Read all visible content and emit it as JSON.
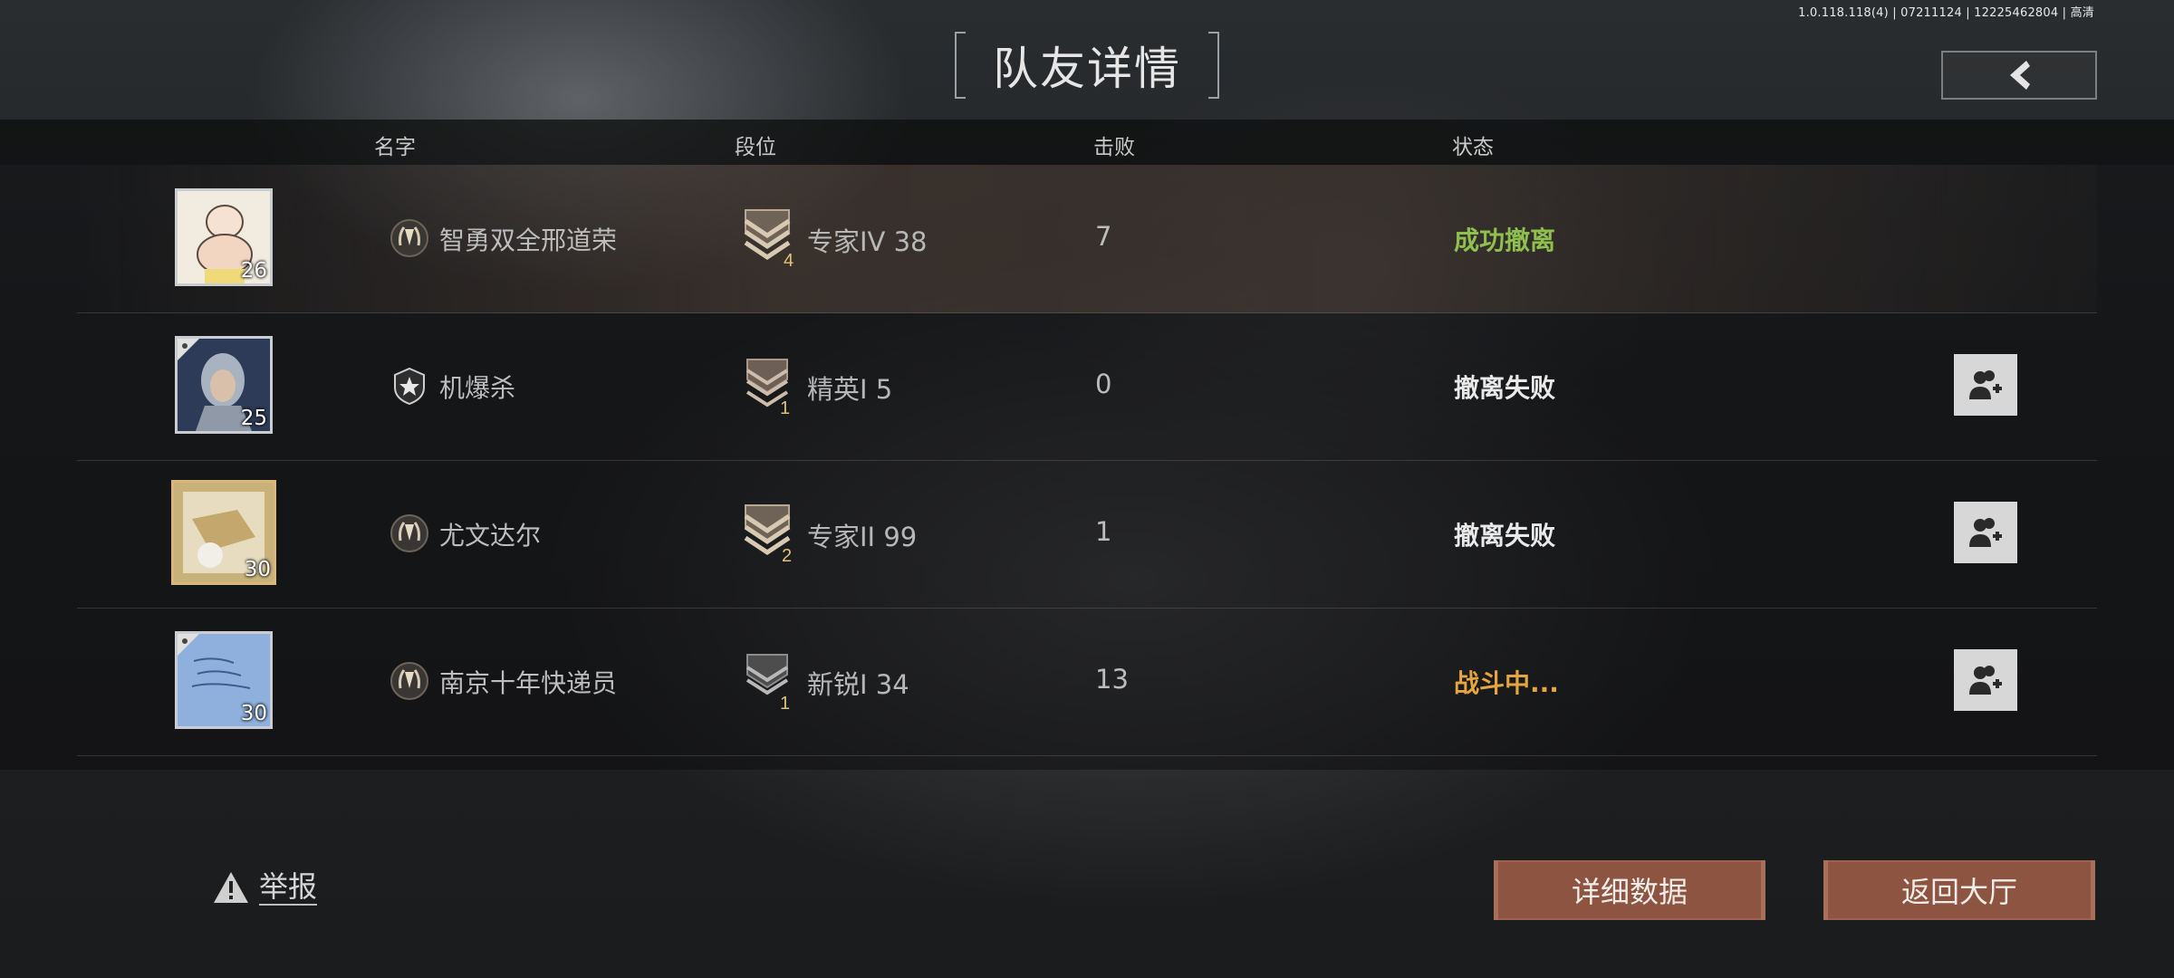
{
  "build_info": "1.0.118.118(4) | 07211124 | 12225462804 | 高清",
  "title": "队友详情",
  "columns": {
    "name": "名字",
    "rank": "段位",
    "kills": "击败",
    "status": "状态"
  },
  "players": [
    {
      "name": "智勇双全邢道荣",
      "level": "26",
      "rank_label": "专家IV 38",
      "rank_tier": "4",
      "kills": "7",
      "status": "成功撤离",
      "status_color": "#8fbf4f",
      "has_add_friend": false,
      "avatar_bg": "#e8dcc4"
    },
    {
      "name": "机爆杀",
      "level": "25",
      "rank_label": "精英I 5",
      "rank_tier": "1",
      "kills": "0",
      "status": "撤离失败",
      "status_color": "#e9e9e9",
      "has_add_friend": true,
      "avatar_bg": "#3b4a68"
    },
    {
      "name": "尤文达尔",
      "level": "30",
      "rank_label": "专家II 99",
      "rank_tier": "2",
      "kills": "1",
      "status": "撤离失败",
      "status_color": "#e9e9e9",
      "has_add_friend": true,
      "avatar_bg": "#c9b27a"
    },
    {
      "name": "南京十年快递员",
      "level": "30",
      "rank_label": "新锐I 34",
      "rank_tier": "1",
      "kills": "13",
      "status": "战斗中...",
      "status_color": "#e6a53e",
      "has_add_friend": true,
      "avatar_bg": "#8fb0dc"
    }
  ],
  "report_label": "举报",
  "buttons": {
    "detail": "详细数据",
    "lobby": "返回大厅"
  },
  "accent_color": "#8d5442"
}
